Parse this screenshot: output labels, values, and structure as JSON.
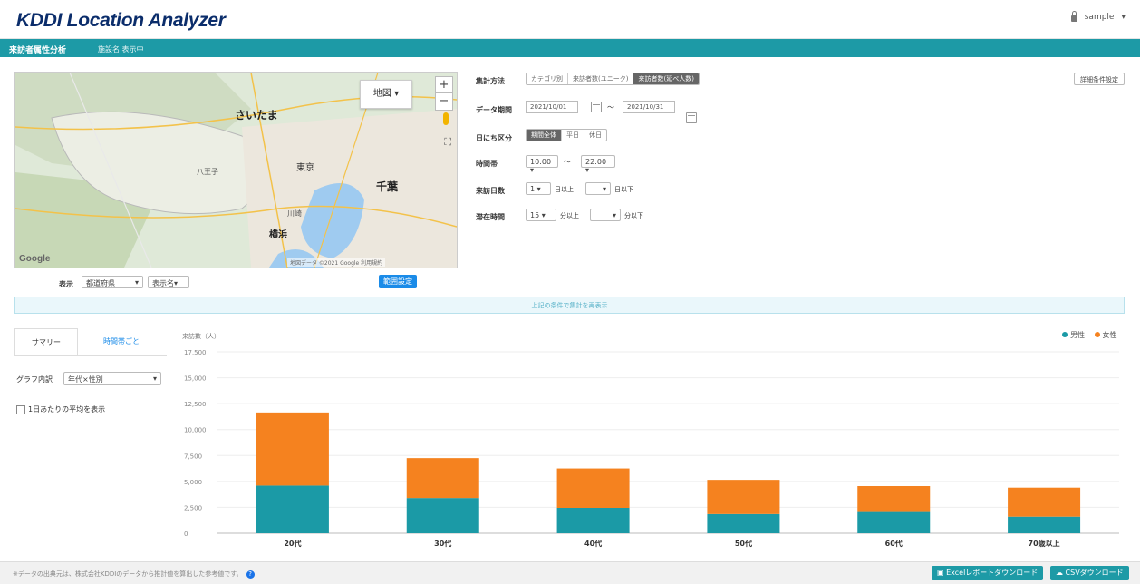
{
  "header": {
    "logo": "KDDI Location Analyzer",
    "user": "sample"
  },
  "subheader": {
    "title": "来訪者属性分析",
    "subtitle": "施設名 表示中"
  },
  "map": {
    "map_type": "地図",
    "zoom_in": "+",
    "zoom_out": "−",
    "labels": [
      "さいたま",
      "千葉",
      "横浜",
      "東京",
      "八王子",
      "川崎"
    ],
    "google": "Google",
    "footer": "地図データ ©2021 Google 利用規約"
  },
  "map_controls": {
    "label": "表示",
    "select1": "都道府県",
    "select2": "表示名",
    "button": "範囲設定"
  },
  "settings": {
    "method_label": "集計方法",
    "method_options": [
      "カテゴリ別",
      "来訪者数(ユニーク)",
      "来訪者数(延べ人数)"
    ],
    "method_selected": 2,
    "detail_button": "詳細条件設定",
    "period_label": "データ期間",
    "date_from": "2021/10/01",
    "tilde": "〜",
    "date_to": "2021/10/31",
    "day_label": "日にち区分",
    "day_options": [
      "期間全体",
      "平日",
      "休日"
    ],
    "day_selected": 0,
    "time_label": "時間帯",
    "time_from": "10:00",
    "time_to": "22:00",
    "visit_label": "来訪日数",
    "visit_from": "1",
    "visit_mid": "日以上",
    "visit_end": "日以下",
    "stay_label": "滞在時間",
    "stay_from": "15",
    "stay_mid": "分以上",
    "stay_end": "分以下"
  },
  "notice": "上記の条件で集計を再表示",
  "left_panel": {
    "tabs": [
      "サマリー",
      "時間帯ごと"
    ],
    "breakdown_label": "グラフ内訳",
    "breakdown_value": "年代×性別",
    "checkbox_label": "1日あたりの平均を表示"
  },
  "chart_data": {
    "type": "bar",
    "stacked": true,
    "ylabel": "来訪数（人）",
    "ylim": [
      0,
      17500
    ],
    "yticks": [
      "0",
      "2,500",
      "5,000",
      "7,500",
      "10,000",
      "12,500",
      "15,000",
      "17,500"
    ],
    "categories": [
      "20代",
      "30代",
      "40代",
      "50代",
      "60代",
      "70歳以上"
    ],
    "series": [
      {
        "name": "男性",
        "color": "#1b9aa6",
        "values": [
          4600,
          3400,
          2450,
          1850,
          2050,
          1600
        ]
      },
      {
        "name": "女性",
        "color": "#f5821f",
        "values": [
          7050,
          3850,
          3800,
          3300,
          2500,
          2800
        ]
      }
    ],
    "legend_position": "top-right",
    "grid": true
  },
  "footer": {
    "note": "※データの出典元は、株式会社KDDIのデータから推計値を算出した参考値です。",
    "help": "?",
    "btn_report": "Excelレポートダウンロード",
    "btn_csv": "CSVダウンロード"
  }
}
